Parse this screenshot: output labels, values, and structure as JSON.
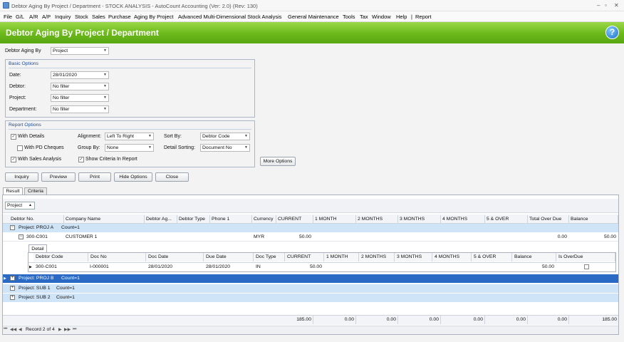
{
  "window": {
    "title": "Debtor Aging By Project / Department - STOCK ANALYSIS - AutoCount Accounting (Ver: 2.0) (Rev: 130)",
    "min": "–",
    "restore": "▫",
    "close": "✕"
  },
  "menu": [
    "File",
    "G/L",
    "A/R",
    "A/P",
    "Inquiry",
    "Stock",
    "Sales",
    "Purchase",
    "Aging By Project",
    "Advanced Multi-Dimensional Stock Analysis",
    "General Maintenance",
    "Tools",
    "Tax",
    "Window",
    "Help",
    "|",
    "Report"
  ],
  "header": {
    "title": "Debtor Aging By Project / Department",
    "help": "?"
  },
  "aging_by": {
    "label": "Debtor Aging By",
    "value": "Project"
  },
  "basic": {
    "title": "Basic Options",
    "date_label": "Date:",
    "date_value": "28/01/2020",
    "debtor_label": "Debtor:",
    "debtor_value": "No filter",
    "project_label": "Project:",
    "project_value": "No filter",
    "department_label": "Department:",
    "department_value": "No filter"
  },
  "report": {
    "title": "Report Options",
    "with_details": "With Details",
    "with_pd": "With PD Cheques",
    "with_sales": "With Sales Analysis",
    "alignment_label": "Alignment:",
    "alignment_value": "Left To Right",
    "group_label": "Group By:",
    "group_value": "None",
    "show_criteria": "Show Criteria In Report",
    "sort_label": "Sort By:",
    "sort_value": "Debtor Code",
    "detail_sort_label": "Detail Sorting:",
    "detail_sort_value": "Document No",
    "more": "More Options"
  },
  "buttons": {
    "inquiry": "Inquiry",
    "preview": "Preview",
    "print": "Print",
    "hide": "Hide Options",
    "close": "Close"
  },
  "tabs": {
    "result": "Result",
    "criteria": "Criteria"
  },
  "groupby_chip": "Project",
  "columns": [
    "Debtor No.",
    "Company Name",
    "Debtor Ag...",
    "Debtor Type",
    "Phone 1",
    "Currency",
    "CURRENT",
    "1 MONTH",
    "2 MONTHS",
    "3 MONTHS",
    "4 MONTHS",
    "5 & OVER",
    "Total Over Due",
    "Balance"
  ],
  "groups": [
    {
      "label": "Project: PROJ A",
      "count": "Count=1"
    },
    {
      "label": "Project: PROJ B",
      "count": "Count=1"
    },
    {
      "label": "Project: SUB 1",
      "count": "Count=1"
    },
    {
      "label": "Project: SUB 2",
      "count": "Count=1"
    }
  ],
  "debtor_row": {
    "no": "300-C001",
    "company": "CUSTOMER 1",
    "currency": "MYR",
    "current": "50.00",
    "total_overdue": "0.00",
    "balance": "50.00"
  },
  "detail": {
    "tab": "Detail",
    "columns": [
      "Debtor Code",
      "Doc No",
      "Doc Date",
      "Due Date",
      "Doc Type",
      "CURRENT",
      "1 MONTH",
      "2 MONTHS",
      "3 MONTHS",
      "4 MONTHS",
      "5 & OVER",
      "Balance",
      "Is OverDue"
    ],
    "row": {
      "code": "300-C001",
      "doc_no": "I-000001",
      "doc_date": "28/01/2020",
      "due_date": "28/01/2020",
      "doc_type": "IN",
      "current": "50.00",
      "balance": "50.00"
    }
  },
  "footer": {
    "current": "185.00",
    "m1": "0.00",
    "m2": "0.00",
    "m3": "0.00",
    "m4": "0.00",
    "m5": "0.00",
    "total": "0.00",
    "balance": "185.00"
  },
  "navigator": {
    "record": "Record 2 of 4"
  }
}
